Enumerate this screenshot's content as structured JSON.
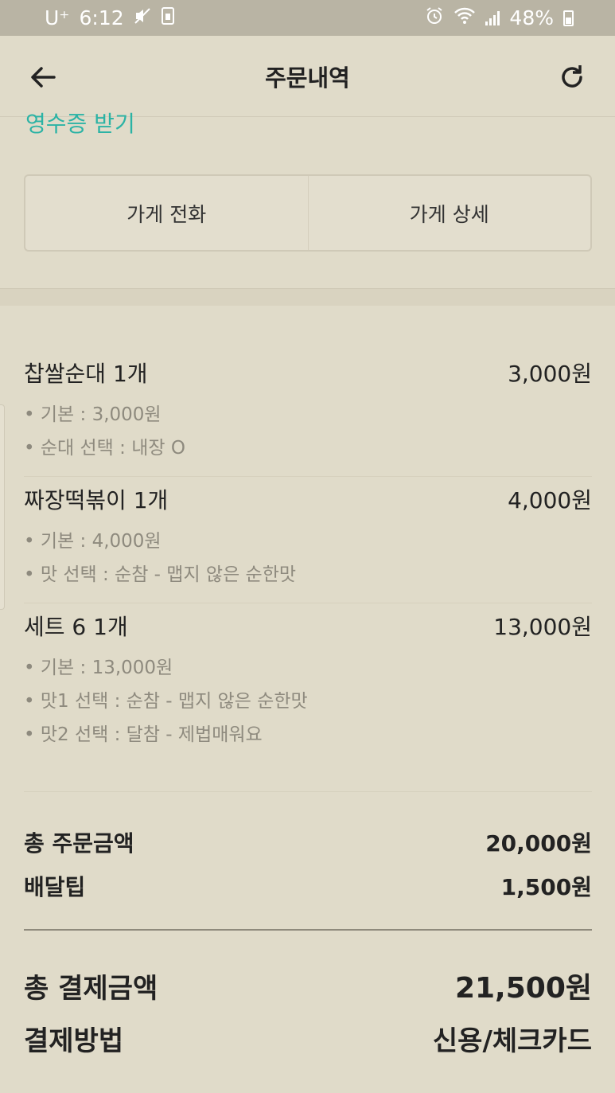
{
  "status_bar": {
    "carrier": "U⁺",
    "time": "6:12",
    "battery": "48%"
  },
  "header": {
    "title": "주문내역"
  },
  "receipt_link": "영수증 받기",
  "store_buttons": {
    "call": "가게 전화",
    "detail": "가게 상세"
  },
  "items": [
    {
      "name": "찹쌀순대 1개",
      "price": "3,000원",
      "options": [
        "• 기본 : 3,000원",
        "• 순대 선택 : 내장 O"
      ]
    },
    {
      "name": "짜장떡볶이 1개",
      "price": "4,000원",
      "options": [
        "• 기본 : 4,000원",
        "• 맛 선택 : 순참 - 맵지 않은 순한맛"
      ]
    },
    {
      "name": "세트 6 1개",
      "price": "13,000원",
      "options": [
        "• 기본 : 13,000원",
        "• 맛1 선택 : 순참 - 맵지 않은 순한맛",
        "• 맛2 선택 : 달참 - 제법매워요"
      ]
    }
  ],
  "totals": {
    "order_label": "총 주문금액",
    "order_value": "20,000원",
    "tip_label": "배달팁",
    "tip_value": "1,500원"
  },
  "payment": {
    "total_label": "총 결제금액",
    "total_value": "21,500원",
    "method_label": "결제방법",
    "method_value": "신용/체크카드"
  }
}
